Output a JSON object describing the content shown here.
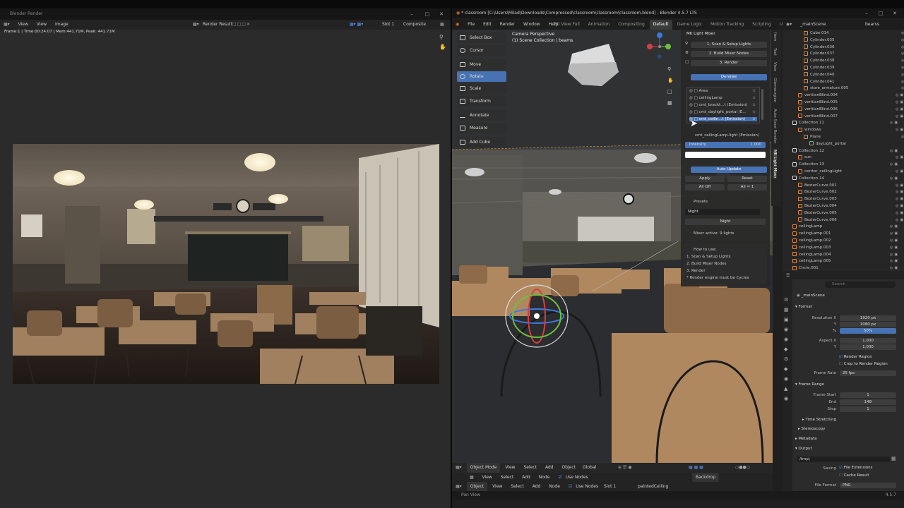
{
  "render_window": {
    "title": "Blender Render",
    "menu": [
      "View",
      "View",
      "Image"
    ],
    "image_name": "Render Result",
    "slot": "Slot 1",
    "pass": "Composite",
    "status": "Frame:1 | Time:00:24.07 | Mem:441.71M, Peak: 441.71M"
  },
  "main_window": {
    "title": "* classroom [C:\\Users\\Milad\\Downloads\\Compressed\\classroom\\classroom\\classroom.blend] - Blender 4.5.7 LTS",
    "menu": [
      "File",
      "Edit",
      "Render",
      "Window",
      "Help"
    ],
    "workspaces": [
      "3D View Full",
      "Animation",
      "Compositing",
      "Default",
      "Game Logic",
      "Motion Tracking",
      "Scripting",
      "UV Editing"
    ],
    "active_workspace": "Default",
    "scene": "_mainScene",
    "view_layer": "bearss"
  },
  "viewport": {
    "title": "Camera Perspective",
    "subtitle": "(1) Scene Collection | beams",
    "mode": "Object Mode",
    "header_menu": [
      "View",
      "Select",
      "Add",
      "Object"
    ],
    "orientation": "Global",
    "tools": [
      {
        "label": "Select Box",
        "active": false
      },
      {
        "label": "Cursor",
        "active": false
      },
      {
        "label": "Move",
        "active": false
      },
      {
        "label": "Rotate",
        "active": true
      },
      {
        "label": "Scale",
        "active": false
      },
      {
        "label": "Transform",
        "active": false
      },
      {
        "label": "Annotate",
        "active": false
      },
      {
        "label": "Measure",
        "active": false
      },
      {
        "label": "Add Cube",
        "active": false
      }
    ]
  },
  "light_mixer": {
    "title": "MK Light Mixer",
    "steps": [
      "1. Scan & Setup Lights",
      "2. Build Mixer Nodes",
      "3. Render"
    ],
    "denoise": "Denoise",
    "lights": [
      "Area",
      "ceilingLamp",
      "cmt_brackt...t (Emission)",
      "cmt_daylight_portal (E...",
      "cmt_ceilin...t (Emission)"
    ],
    "selected_light": "cmt_ceilingLamp.light (Emission)",
    "intensity_label": "Intensity",
    "intensity_value": "1.000",
    "auto_update": "Auto Update",
    "apply": "Apply",
    "reset": "Reset",
    "all_off": "All Off",
    "all_one": "All = 1",
    "presets_label": "Presets",
    "preset_name": "Night",
    "preset_button": "Night",
    "mixer_active": "Mixer active: 9 lights",
    "howto_title": "How to use:",
    "howto": [
      "1. Scan & Setup Lights",
      "2. Build Mixer Nodes",
      "3. Render",
      "* Render engine must be Cycles"
    ]
  },
  "side_tabs": [
    "Item",
    "Tool",
    "View",
    "Glamourgize",
    "Auto Save Render",
    "MK Light Mixer"
  ],
  "outliner": {
    "rows": [
      {
        "label": "Cube.014",
        "indent": 3,
        "color": "#e08a3c"
      },
      {
        "label": "Cylinder.035",
        "indent": 3,
        "color": "#e08a3c"
      },
      {
        "label": "Cylinder.036",
        "indent": 3,
        "color": "#e08a3c"
      },
      {
        "label": "Cylinder.037",
        "indent": 3,
        "color": "#e08a3c"
      },
      {
        "label": "Cylinder.038",
        "indent": 3,
        "color": "#e08a3c"
      },
      {
        "label": "Cylinder.039",
        "indent": 3,
        "color": "#e08a3c"
      },
      {
        "label": "Cylinder.040",
        "indent": 3,
        "color": "#e08a3c"
      },
      {
        "label": "Cylinder.041",
        "indent": 3,
        "color": "#e08a3c"
      },
      {
        "label": "store_armature.005",
        "indent": 3,
        "color": "#e08a3c"
      },
      {
        "label": "veritianBlind.004",
        "indent": 2,
        "color": "#e08a3c"
      },
      {
        "label": "veritianBlind.005",
        "indent": 2,
        "color": "#e08a3c"
      },
      {
        "label": "veritianBlind.006",
        "indent": 2,
        "color": "#e08a3c"
      },
      {
        "label": "veritianBlind.007",
        "indent": 2,
        "color": "#e08a3c"
      },
      {
        "label": "Collection 11",
        "indent": 1,
        "color": "#dddddd"
      },
      {
        "label": "windows",
        "indent": 2,
        "color": "#e08a3c"
      },
      {
        "label": "Plane",
        "indent": 3,
        "color": "#e08a3c"
      },
      {
        "label": "dayLight_portal",
        "indent": 4,
        "color": "#5ad16b"
      },
      {
        "label": "Collection 12",
        "indent": 1,
        "color": "#dddddd"
      },
      {
        "label": "sun",
        "indent": 2,
        "color": "#e08a3c"
      },
      {
        "label": "Collection 13",
        "indent": 1,
        "color": "#dddddd"
      },
      {
        "label": "cerrtor_ceilingLight",
        "indent": 2,
        "color": "#e08a3c"
      },
      {
        "label": "Collection 14",
        "indent": 1,
        "color": "#dddddd"
      },
      {
        "label": "BezierCurve.001",
        "indent": 2,
        "color": "#e08a3c"
      },
      {
        "label": "BezierCurve.002",
        "indent": 2,
        "color": "#e08a3c"
      },
      {
        "label": "BezierCurve.003",
        "indent": 2,
        "color": "#e08a3c"
      },
      {
        "label": "BezierCurve.004",
        "indent": 2,
        "color": "#e08a3c"
      },
      {
        "label": "BezierCurve.005",
        "indent": 2,
        "color": "#e08a3c"
      },
      {
        "label": "BezierCurve.006",
        "indent": 2,
        "color": "#e08a3c"
      },
      {
        "label": "ceilingLamp",
        "indent": 1,
        "color": "#e08a3c"
      },
      {
        "label": "ceilingLamp.001",
        "indent": 1,
        "color": "#e08a3c"
      },
      {
        "label": "ceilingLamp.002",
        "indent": 1,
        "color": "#e08a3c"
      },
      {
        "label": "ceilingLamp.003",
        "indent": 1,
        "color": "#e08a3c"
      },
      {
        "label": "ceilingLamp.004",
        "indent": 1,
        "color": "#e08a3c"
      },
      {
        "label": "ceilingLamp.005",
        "indent": 1,
        "color": "#e08a3c"
      },
      {
        "label": "Circle.001",
        "indent": 1,
        "color": "#e08a3c"
      }
    ]
  },
  "properties": {
    "search_placeholder": "Search",
    "scene": "_mainScene",
    "format_section": "Format",
    "resolution_x_label": "Resolution X",
    "resolution_x": "1920 px",
    "resolution_y_label": "Y",
    "resolution_y": "1080 px",
    "resolution_pct_label": "%",
    "resolution_pct": "50%",
    "aspect_x_label": "Aspect X",
    "aspect_x": "1.000",
    "aspect_y_label": "Y",
    "aspect_y": "1.000",
    "render_region": "Render Region",
    "crop_region": "Crop to Render Region",
    "frame_rate_label": "Frame Rate",
    "frame_rate": "25 fps",
    "frame_range_section": "Frame Range",
    "frame_start_label": "Frame Start",
    "frame_start": "1",
    "end_label": "End",
    "end": "148",
    "step_label": "Step",
    "step": "1",
    "time_stretching": "Time Stretching",
    "stereoscopy": "Stereoscopy",
    "metadata": "Metadata",
    "output_section": "Output",
    "output_path": "/tmp\\",
    "saving_label": "Saving",
    "file_extensions": "File Extensions",
    "cache_result": "Cache Result",
    "file_format_label": "File Format",
    "file_format": "PNG"
  },
  "node_editor": {
    "row1": [
      "View",
      "Select",
      "Add",
      "Node"
    ],
    "use_nodes": "Use Nodes",
    "backdrop": "Backdrop",
    "row2_type": "Object",
    "row2": [
      "View",
      "Select",
      "Add",
      "Node"
    ],
    "slot": "Slot 1",
    "material": "paintedCeiling",
    "status": "Pan View",
    "version": "4.5.7"
  }
}
